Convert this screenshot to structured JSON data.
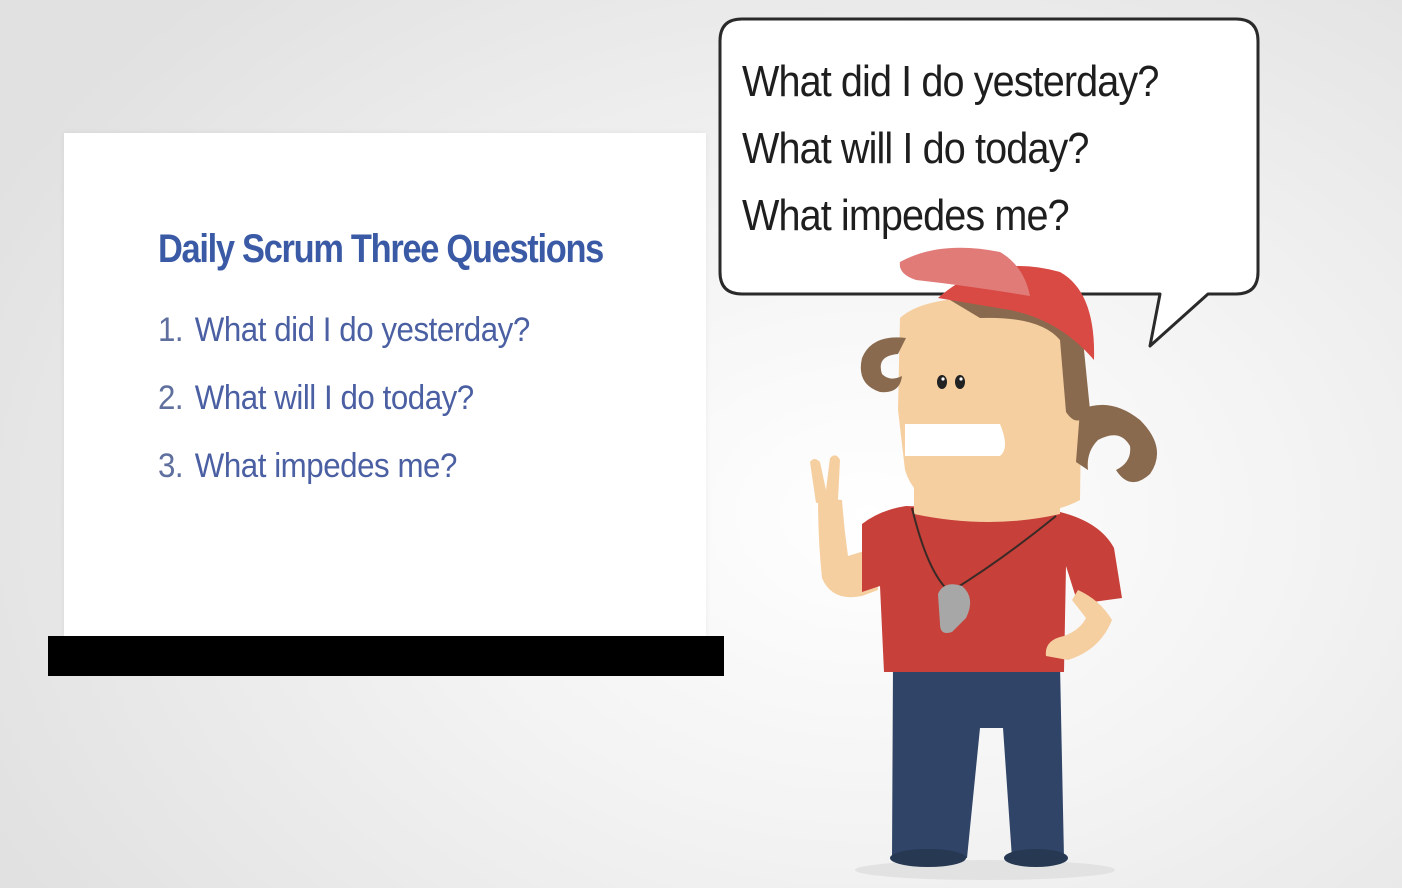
{
  "whiteboard": {
    "title": "Daily Scrum Three Questions",
    "items": [
      {
        "number": "1.",
        "text": "What did I do yesterday?"
      },
      {
        "number": "2.",
        "text": "What will I do today?"
      },
      {
        "number": "3.",
        "text": "What impedes me?"
      }
    ]
  },
  "speech_bubble": {
    "lines": [
      "What did I do yesterday?",
      "What will I do today?",
      "What impedes me?"
    ]
  },
  "colors": {
    "title": "#3a5aa6",
    "list_text": "#4b5fa3",
    "bubble_text": "#1e1e1e",
    "shirt": "#c8403a",
    "cap": "#d94a44",
    "skin": "#f5cfa0",
    "hair": "#8a6a4e",
    "pants": "#2f4466"
  }
}
